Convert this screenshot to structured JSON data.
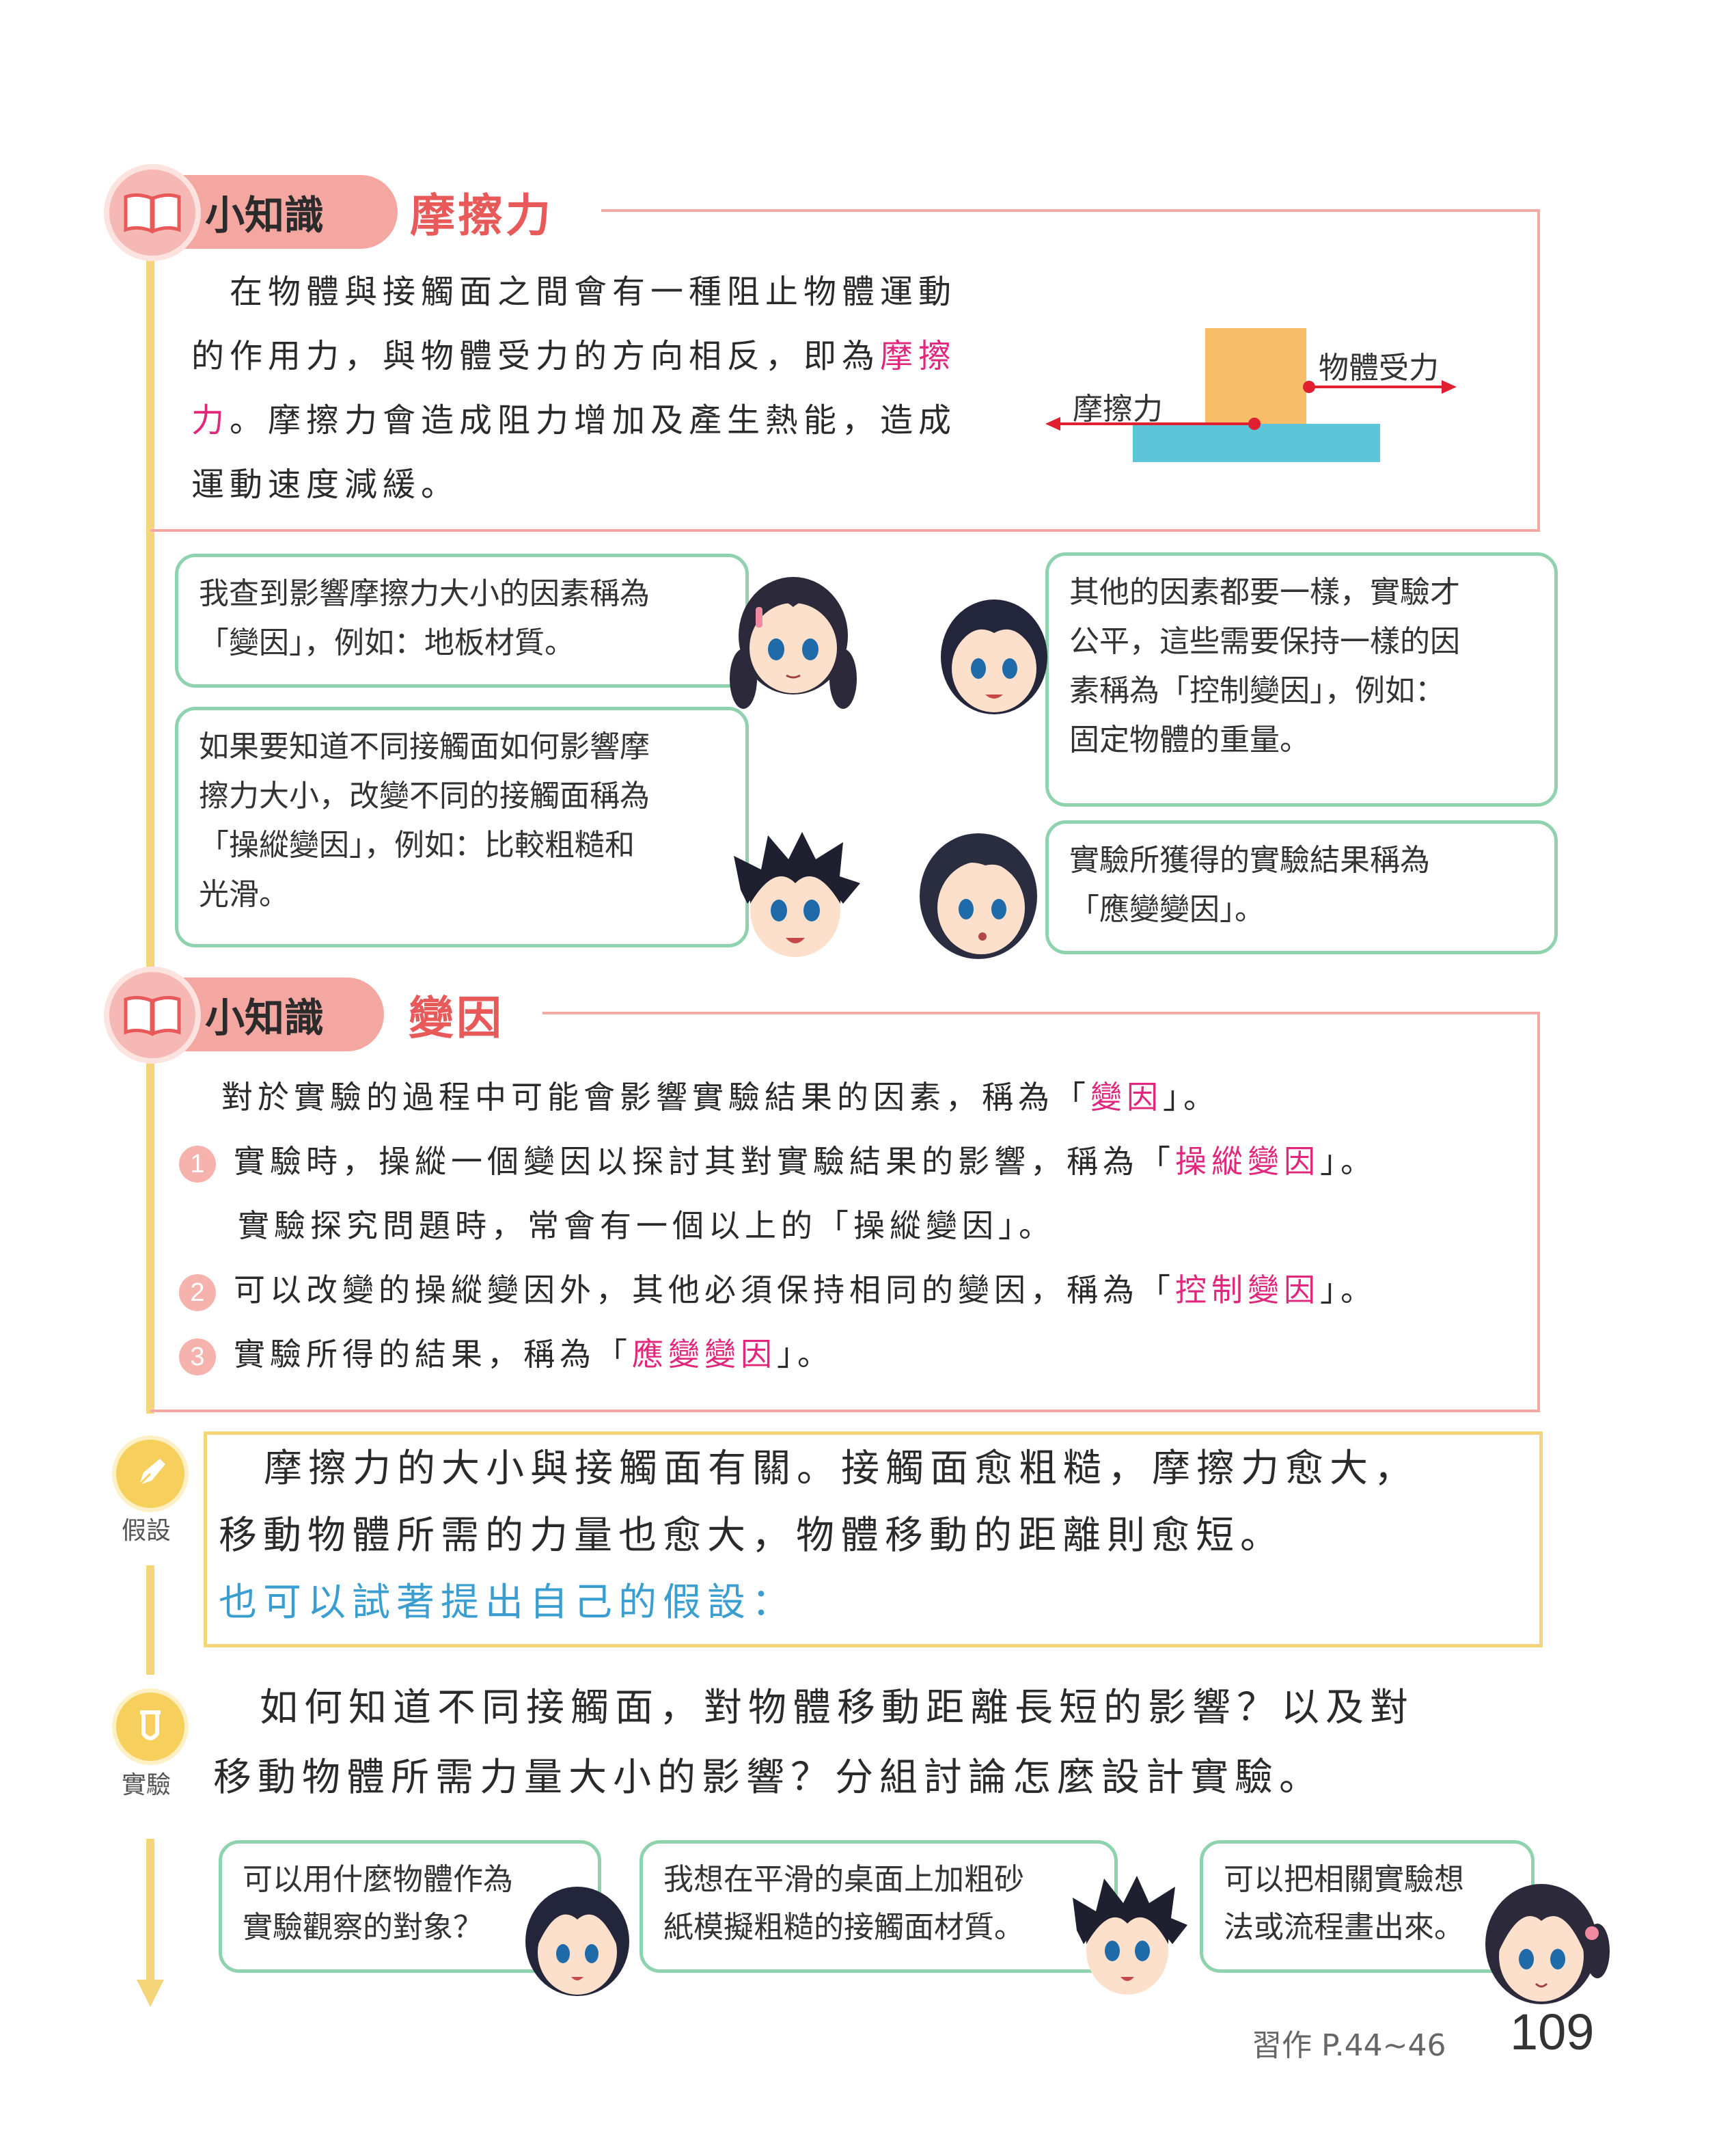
{
  "knowledge1": {
    "badge": "小知識",
    "title": "摩擦力",
    "text_a": "在物體與接觸面之間會有一種阻止物體運動",
    "text_b": "的作用力，與物體受力的方向相反，即為",
    "text_b_hl": "摩擦",
    "text_c_hl": "力",
    "text_c": "。摩擦力會造成阻力增加及產生熱能，造成",
    "text_d": "運動速度減緩。",
    "diagram": {
      "label_force": "物體受力",
      "label_friction": "摩擦力",
      "block_color": "#f7bd68",
      "surface_color": "#5cc6d8",
      "arrow_color": "#e02030"
    }
  },
  "bubbles": {
    "b1": [
      "我查到影響摩擦力大小的因素稱為",
      "「變因」，例如：地板材質。"
    ],
    "b2": [
      "如果要知道不同接觸面如何影響摩",
      "擦力大小，改變不同的接觸面稱為",
      "「操縱變因」，例如：比較粗糙和",
      "光滑。"
    ],
    "b3": [
      "其他的因素都要一樣，實驗才",
      "公平，這些需要保持一樣的因",
      "素稱為「控制變因」，例如：",
      "固定物體的重量。"
    ],
    "b4": [
      "實驗所獲得的實驗結果稱為",
      "「應變變因」。"
    ]
  },
  "knowledge2": {
    "badge": "小知識",
    "title": "變因",
    "intro_a": "對於實驗的過程中可能會影響實驗結果的因素，稱為「",
    "intro_hl": "變因",
    "intro_b": "」。",
    "items": [
      {
        "num": "1",
        "a": "實驗時，操縱一個變因以探討其對實驗結果的影響，稱為「",
        "hl": "操縱變因",
        "b": "」。"
      },
      {
        "num": "2",
        "a": "可以改變的操縱變因外，其他必須保持相同的變因，稱為「",
        "hl": "控制變因",
        "b": "」。"
      },
      {
        "num": "3",
        "a": "實驗所得的結果，稱為「",
        "hl": "應變變因",
        "b": "」。"
      }
    ],
    "item1_cont": "實驗探究問題時，常會有一個以上的「操縱變因」。"
  },
  "hypothesis": {
    "label": "假設",
    "line1": "摩擦力的大小與接觸面有關。接觸面愈粗糙，摩擦力愈大，",
    "line2": "移動物體所需的力量也愈大，物體移動的距離則愈短。",
    "line3": "也可以試著提出自己的假設："
  },
  "experiment": {
    "label": "實驗",
    "line1": "如何知道不同接觸面，對物體移動距離長短的影響？以及對",
    "line2": "移動物體所需力量大小的影響？分組討論怎麼設計實驗。",
    "bubbles": [
      [
        "可以用什麼物體作為",
        "實驗觀察的對象？"
      ],
      [
        "我想在平滑的桌面上加粗砂",
        "紙模擬粗糙的接觸面材質。"
      ],
      [
        "可以把相關實驗想",
        "法或流程畫出來。"
      ]
    ]
  },
  "footer": {
    "workbook": "習作 P.44~46",
    "page": "109"
  }
}
